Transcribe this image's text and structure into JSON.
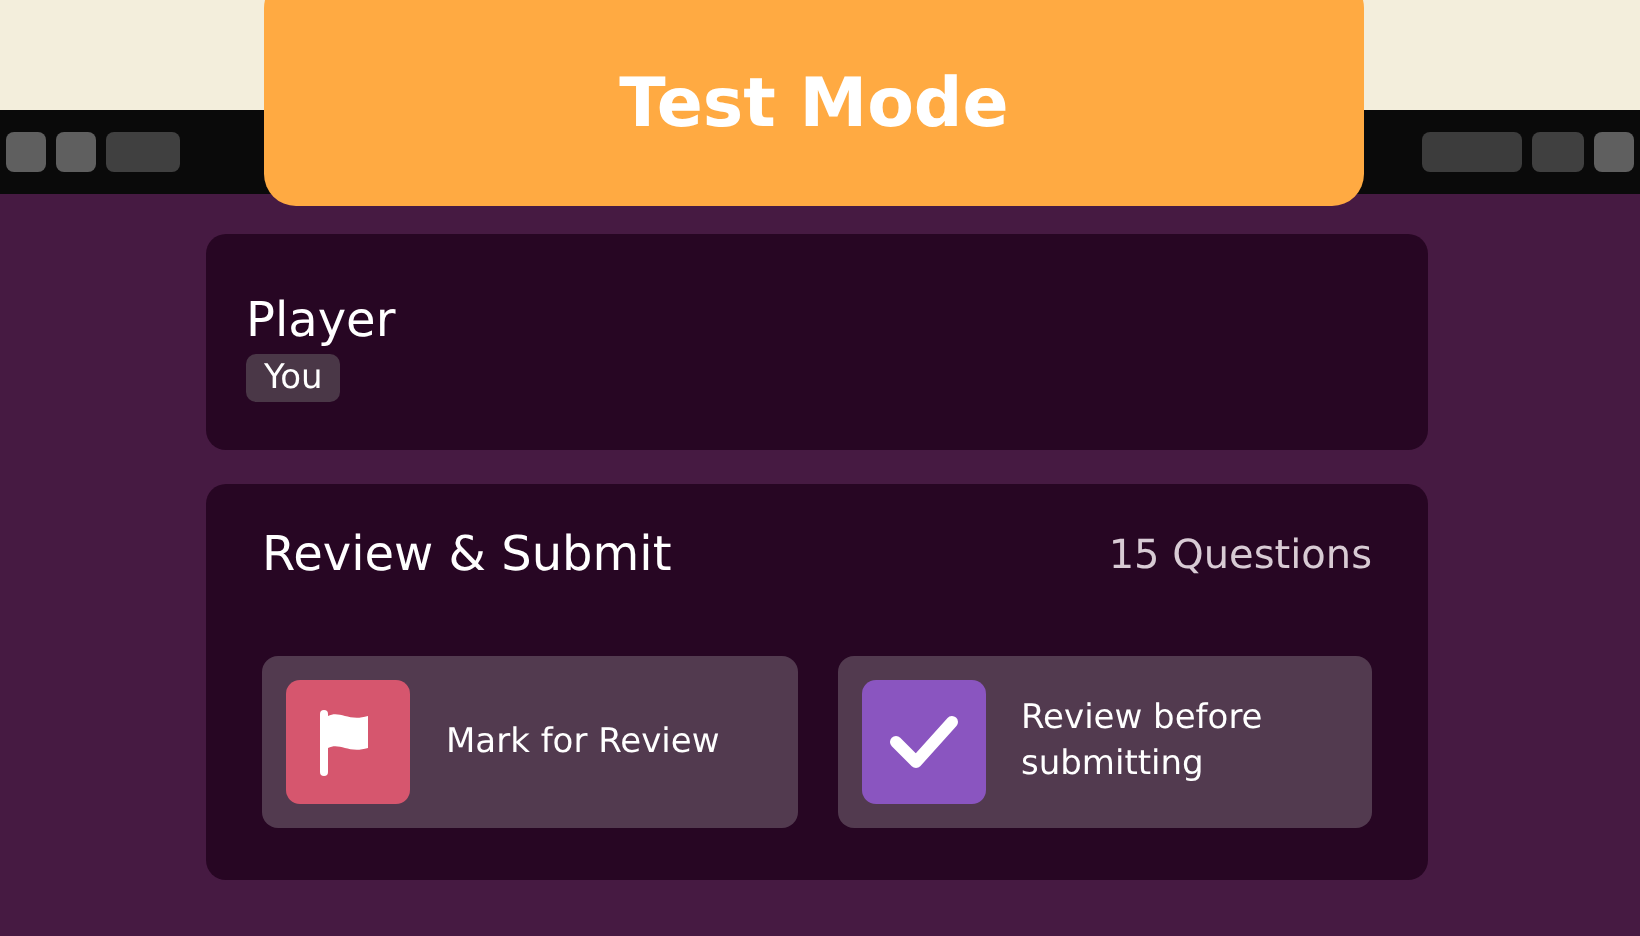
{
  "banner": {
    "title": "Test Mode"
  },
  "player": {
    "heading": "Player",
    "name": "You"
  },
  "review": {
    "title": "Review & Submit",
    "count": "15 Questions",
    "features": [
      {
        "kind": "flag",
        "label": "Mark for Review",
        "color": "#d6566e"
      },
      {
        "kind": "check",
        "label": "Review before submitting",
        "color": "#8a55c0"
      }
    ]
  }
}
